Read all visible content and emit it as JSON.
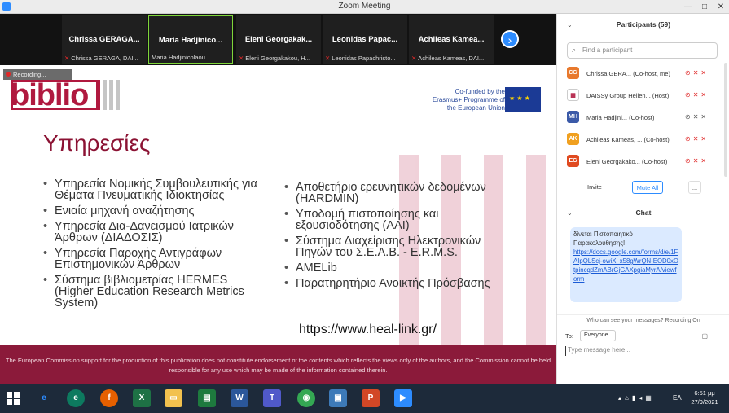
{
  "window": {
    "title": "Zoom Meeting"
  },
  "gallery": {
    "tiles": [
      {
        "name": "Chrissa GERAGA...",
        "sub": "Chrissa GERAGA, DAI..."
      },
      {
        "name": "Maria Hadjinico...",
        "sub": "Maria Hadjinicolaou"
      },
      {
        "name": "Eleni Georgakak...",
        "sub": "Eleni Georgakakou, H..."
      },
      {
        "name": "Leonidas Papac...",
        "sub": "Leonidas Papachristo..."
      },
      {
        "name": "Achileas Kamea...",
        "sub": "Achileas Kameas, DAI..."
      }
    ],
    "next": "›"
  },
  "slide": {
    "recording": "Recording...",
    "logo": "biblio",
    "erasmus_text": "Co-funded by the Erasmus+ Programme of the European Union",
    "heading": "Υπηρεσίες",
    "col1": [
      "Υπηρεσία Νομικής Συμβουλευτικής για Θέματα Πνευματικής Ιδιοκτησίας",
      "Ενιαία μηχανή αναζήτησης",
      "Υπηρεσία Δια-Δανεισμού Ιατρικών Άρθρων (ΔΙΑΔΟΣΙΣ)",
      "Υπηρεσία Παροχής Αντιγράφων Επιστημονικών Άρθρων",
      "Σύστημα βιβλιομετρίας HERMES (Higher Education Research Metrics System)"
    ],
    "col2": [
      "Αποθετήριο ερευνητικών δεδομένων (HARDMIN)",
      "Υποδομή πιστοποίησης και εξουσιοδότησης (AAI)",
      "Σύστημα Διαχείρισης Ηλεκτρονικών Πηγών του Σ.Ε.Α.Β. - E.R.M.S.",
      "AMELib",
      "Παρατηρητήριο Ανοικτής Πρόσβασης"
    ],
    "url": "https://www.heal-link.gr/",
    "footer": "The European Commission support for the production of this publication does not constitute endorsement of the contents which reflects the views only of the authors, and the Commission cannot be held responsible for any use which may be made of the information contained therein."
  },
  "participants": {
    "header": "Participants (59)",
    "search_placeholder": "Find a participant",
    "list": [
      {
        "initials": "CG",
        "color": "#e8792d",
        "name": "Chrissa GERA... (Co-host, me)"
      },
      {
        "initials": "",
        "color": "#ffffff",
        "name": "DAISSy Group Hellen... (Host)"
      },
      {
        "initials": "MH",
        "color": "#3b5aa8",
        "name": "Maria Hadjini... (Co-host)"
      },
      {
        "initials": "AK",
        "color": "#f0a020",
        "name": "Achileas Kameas, ... (Co-host)"
      },
      {
        "initials": "EG",
        "color": "#e04a20",
        "name": "Eleni Georgakako... (Co-host)"
      }
    ],
    "invite": "Invite",
    "mute_all": "Mute All",
    "more": "..."
  },
  "chat": {
    "header": "Chat",
    "message_text": "δίνεται Πιστοποιητικό Παρακολούθησης!",
    "message_link": "https://docs.google.com/forms/d/e/1FAIpQLScj-owiX_x58gWrQN-EOD0xOtpincqdZmABrGjGAXpgiaMyrA/viewform",
    "visibility": "Who can see your messages? Recording On",
    "to_label": "To:",
    "to_value": "Everyone",
    "input_placeholder": "Type message here..."
  },
  "taskbar": {
    "lang": "ΕΛ",
    "time": "6:51 μμ",
    "date": "27/9/2021"
  }
}
